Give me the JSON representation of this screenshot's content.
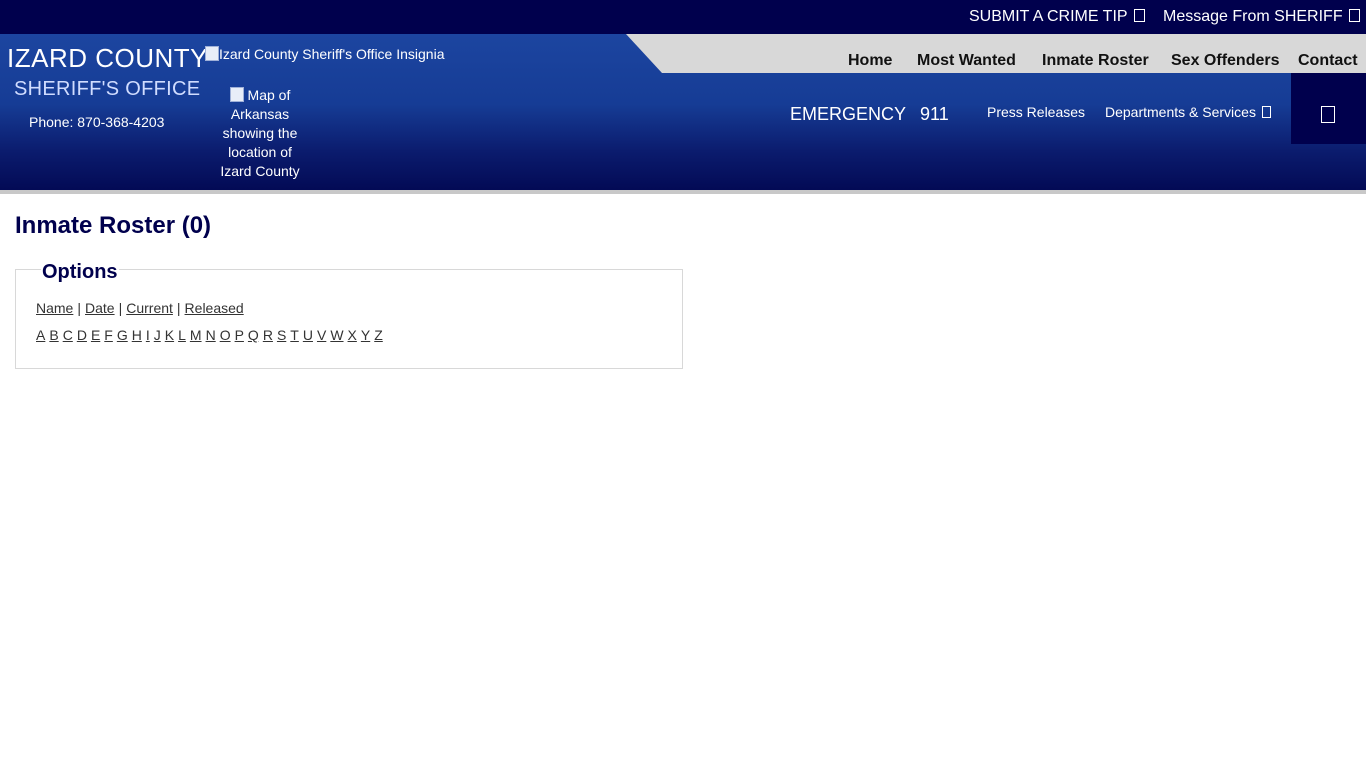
{
  "topbar": {
    "crime_tip_part1": "SUBMIT A ",
    "crime_tip_part2": "CRIME TIP",
    "message_part1": "Message From ",
    "message_part2": "SHERIFF"
  },
  "brand": {
    "county": "IZARD COUNTY",
    "office": "SHERIFF'S OFFICE",
    "phone_label": "Phone:",
    "phone": "870-368-4203",
    "insignia_alt": "Izard County Sheriff's Office Insignia",
    "map_alt": "Map of Arkansas showing the location of Izard County"
  },
  "nav": {
    "home": "Home",
    "most_wanted": "Most Wanted",
    "inmate_roster": "Inmate Roster",
    "sex_offenders": "Sex Offenders",
    "contact": "Contact"
  },
  "subnav": {
    "emergency_label": "EMERGENCY",
    "emergency_number": "911",
    "press_releases": "Press Releases",
    "departments": "Departments & Services"
  },
  "main": {
    "title": "Inmate Roster (0)",
    "options_legend": "Options",
    "sort_links": [
      "Name",
      "Date",
      "Current",
      "Released"
    ],
    "separator": "|",
    "letters": [
      "A",
      "B",
      "C",
      "D",
      "E",
      "F",
      "G",
      "H",
      "I",
      "J",
      "K",
      "L",
      "M",
      "N",
      "O",
      "P",
      "Q",
      "R",
      "S",
      "T",
      "U",
      "V",
      "W",
      "X",
      "Y",
      "Z"
    ]
  },
  "colors": {
    "navy": "#00004d",
    "header_blue": "#1c45a0",
    "nav_grey": "#d8d8d8"
  }
}
